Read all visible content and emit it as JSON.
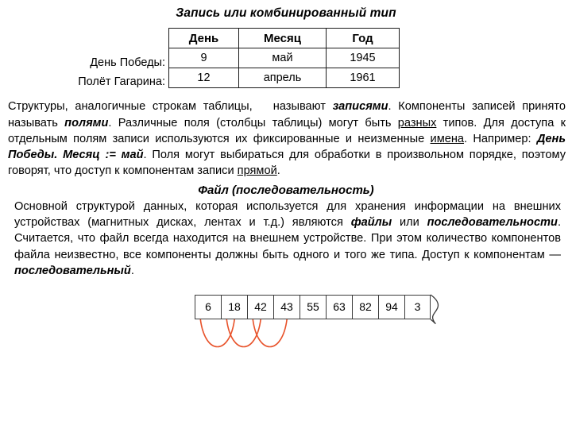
{
  "record_section": {
    "title": "Запись или комбинированный тип",
    "table": {
      "headers": [
        "День",
        "Месяц",
        "Год"
      ],
      "row_labels": [
        "День Победы:",
        "Полёт Гагарина:"
      ],
      "rows": [
        [
          "9",
          "май",
          "1945"
        ],
        [
          "12",
          "апрель",
          "1961"
        ]
      ]
    },
    "paragraph": {
      "part1": "Структуры, аналогичные строкам таблицы,",
      "part2": "называют ",
      "em1": "записями",
      "part3": ". Компоненты записей принято называть ",
      "em2": "полями",
      "part4": ". Различные поля (столбцы таблицы) могут быть ",
      "u1": "разных",
      "part5": " типов.  Для доступа к отдельным полям записи используются их фиксированные и неизменные ",
      "u2": "имена",
      "part6": ". Например: ",
      "em3": "День Победы. Месяц := май",
      "part7": ". Поля могут выбираться для обработки в произвольном порядке, поэтому говорят, что доступ к компонентам записи ",
      "u3": "прямой",
      "part8": "."
    }
  },
  "file_section": {
    "title": "Файл (последовательность)",
    "paragraph": {
      "part1": "Основной структурой данных, которая используется для хранения информации на внешних устройствах (магнитных дисках, лентах и т.д.) являются ",
      "em1": "файлы",
      "part2": " или ",
      "em2": "последовательности",
      "part3": ". Считается, что файл всегда находится на внешнем устройстве. При этом количество компонентов файла неизвестно, все компоненты должны быть одного и того же типа. Доступ к компонентам — ",
      "em3": "последовательный",
      "part4": "."
    },
    "sequence": {
      "cells": [
        "6",
        "18",
        "42",
        "43",
        "55",
        "63",
        "82",
        "94",
        "3"
      ],
      "arc_color": "#E8522A",
      "border_color": "#3a3a3a",
      "continues_marker": "torn-edge"
    }
  }
}
